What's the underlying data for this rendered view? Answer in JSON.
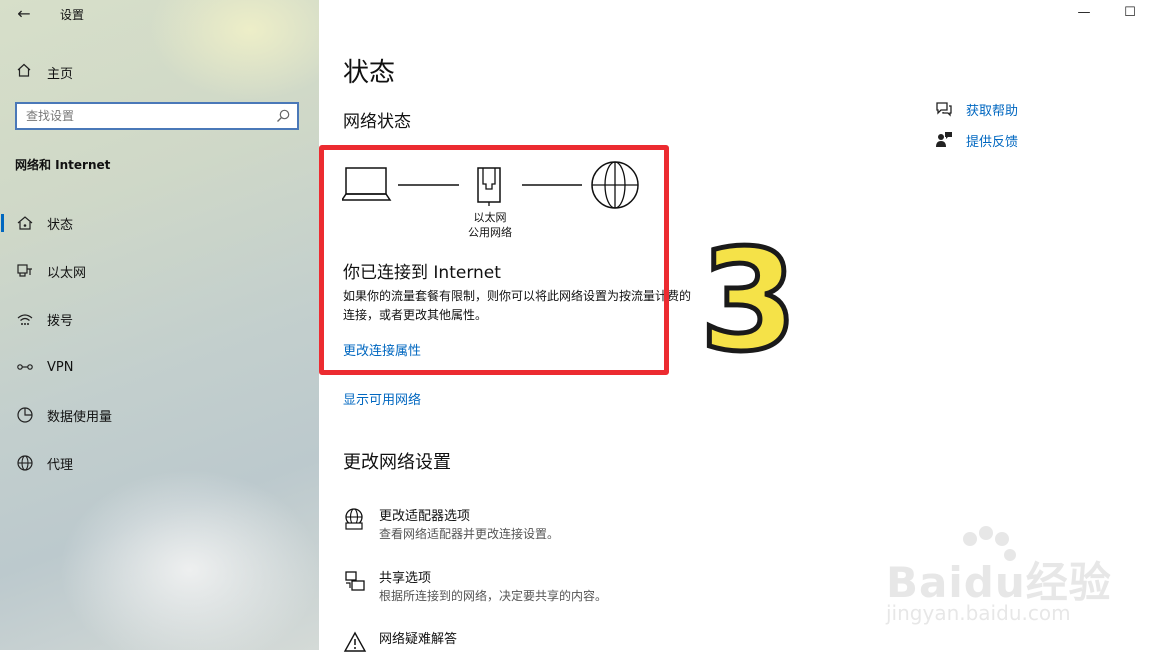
{
  "window": {
    "back_glyph": "←",
    "title": "设置",
    "minimize_glyph": "—",
    "maximize_glyph": "☐"
  },
  "sidebar": {
    "home_label": "主页",
    "search_placeholder": "查找设置",
    "section_heading": "网络和 Internet",
    "items": [
      {
        "label": "状态",
        "icon": "home-status-icon",
        "selected": true
      },
      {
        "label": "以太网",
        "icon": "ethernet-icon"
      },
      {
        "label": "拨号",
        "icon": "dialup-icon"
      },
      {
        "label": "VPN",
        "icon": "vpn-icon"
      },
      {
        "label": "数据使用量",
        "icon": "data-usage-icon"
      },
      {
        "label": "代理",
        "icon": "globe-icon"
      }
    ]
  },
  "main": {
    "page_title": "状态",
    "network_status_heading": "网络状态",
    "diagram": {
      "adapter_name": "以太网",
      "network_type": "公用网络"
    },
    "connected_title": "你已连接到 Internet",
    "connected_desc_line1": "如果你的流量套餐有限制，则你可以将此网络设置为按流量计费的",
    "connected_desc_line2": "连接，或者更改其他属性。",
    "change_props_link": "更改连接属性",
    "show_networks_link": "显示可用网络",
    "change_settings_heading": "更改网络设置",
    "options": [
      {
        "title": "更改适配器选项",
        "desc": "查看网络适配器并更改连接设置。",
        "icon": "adapter-globe-icon"
      },
      {
        "title": "共享选项",
        "desc": "根据所连接到的网络，决定要共享的内容。",
        "icon": "sharing-icon"
      },
      {
        "title": "网络疑难解答",
        "desc": "",
        "icon": "warning-icon"
      }
    ]
  },
  "help": {
    "get_help": "获取帮助",
    "feedback": "提供反馈"
  },
  "annotation": {
    "step_number": "3",
    "highlight_color": "#ec2b30"
  },
  "watermark": {
    "brand": "Baidu经验",
    "url": "jingyan.baidu.com"
  },
  "colors": {
    "accent": "#0067c0"
  }
}
